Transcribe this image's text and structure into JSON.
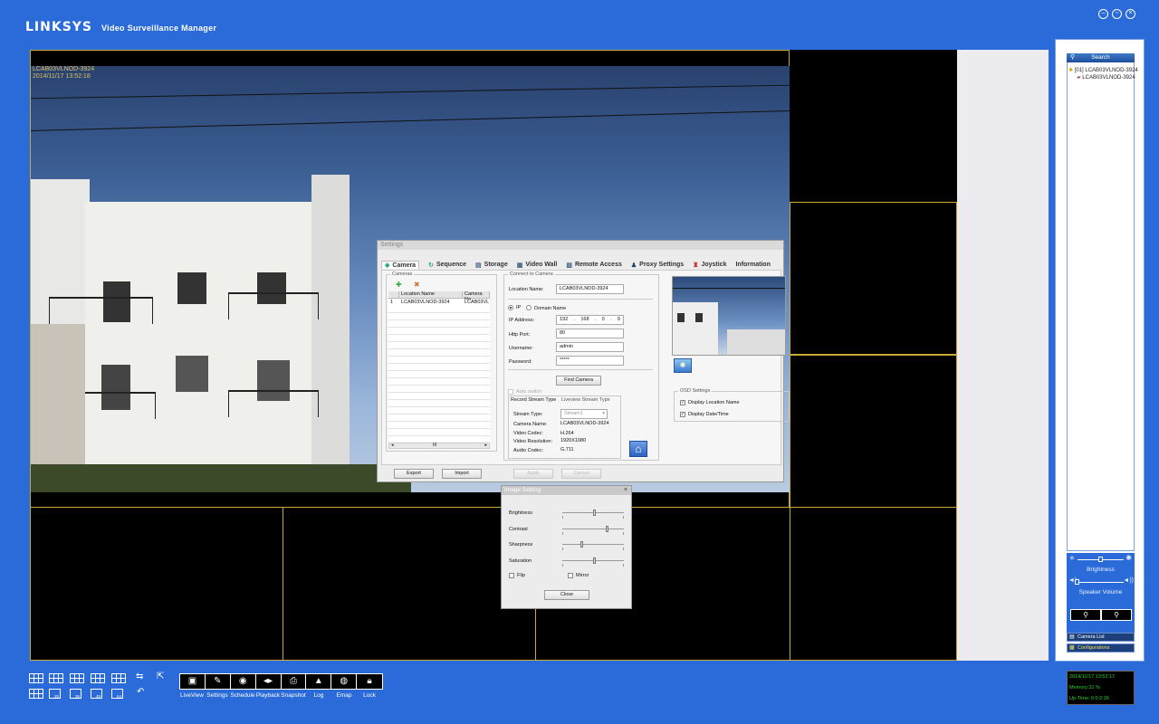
{
  "app": {
    "brand": "LINKSYS",
    "title": "Video Surveillance Manager",
    "window_buttons": [
      "minimize-icon",
      "restore-icon",
      "close-icon"
    ]
  },
  "camera_view": {
    "location_name": "LCAB03VLNOD-3924",
    "datetime": "2014/11/17 13:52:18"
  },
  "settings_dialog": {
    "title": "Settings",
    "tabs": [
      {
        "label": "Camera",
        "icon": "camera-icon"
      },
      {
        "label": "Sequence",
        "icon": "sequence-icon"
      },
      {
        "label": "Storage",
        "icon": "storage-icon"
      },
      {
        "label": "Video Wall",
        "icon": "video-wall-icon"
      },
      {
        "label": "Remote Access",
        "icon": "remote-access-icon"
      },
      {
        "label": "Proxy Settings",
        "icon": "proxy-icon"
      },
      {
        "label": "Joystick",
        "icon": "joystick-icon"
      },
      {
        "label": "Information",
        "icon": ""
      }
    ],
    "cameras_group": "Cameras",
    "table_headers": [
      "Location Name",
      "Camera Na"
    ],
    "table_rows": [
      {
        "index": "1",
        "location": "LCAB03VLNOD-3924",
        "camera": "LCAB03VL"
      }
    ],
    "connect_group": "Connect to Camera",
    "location_label": "Location Name:",
    "location_value": "LCAB03VLNOD-3924",
    "ip_radio": "IP",
    "domain_radio": "Domain Name",
    "ip_label": "IP Address:",
    "ip_octets": [
      "192",
      "168",
      "0",
      "9"
    ],
    "http_label": "Http Port:",
    "http_value": "80",
    "username_label": "Username:",
    "username_value": "admin",
    "password_label": "Password:",
    "password_value": "*****",
    "find_camera": "Find Camera",
    "auto_switch": "Auto switch",
    "stream_tabs": [
      "Record Stream Type",
      "Liveview Stream Type"
    ],
    "stream_type_label": "Stream Type:",
    "stream_type_value": "Stream1",
    "camera_name_label": "Camera Name:",
    "camera_name_value": "LCAB03VLNOD-3924",
    "video_codec_label": "Video Codec:",
    "video_codec_value": "H.264",
    "video_res_label": "Video Resolution:",
    "video_res_value": "1920X1080",
    "audio_codec_label": "Audio Codec:",
    "audio_codec_value": "G.711",
    "osd_group": "OSD Settings",
    "osd_location": "Display Location Name",
    "osd_datetime": "Display Date/Time",
    "export": "Export",
    "import": "Import",
    "apply": "Apply",
    "cancel": "Cancel",
    "scroll_grip": "III"
  },
  "image_setting": {
    "title": "Image Setting",
    "close": "×",
    "brightness": "Brightness",
    "contrast": "Contrast",
    "sharpness": "Sharpness",
    "saturation": "Saturation",
    "brightness_level": 0.5,
    "contrast_level": 0.7,
    "sharpness_level": 0.3,
    "saturation_level": 0.5,
    "flip": "Flip",
    "mirror": "Mirror",
    "close_btn": "Close"
  },
  "right_panel": {
    "search": "Search",
    "tree_root": "[01] LCAB03VLNOD-3924",
    "tree_child": "LCAB03VLNOD-3924",
    "brightness": "Brightness",
    "speaker_volume": "Speaker Volume",
    "camera_list": "Camera List",
    "configurations": "Configurations"
  },
  "status": {
    "datetime": "2014/11/17 13:52:17",
    "memory": "Memory:31 %",
    "uptime": "Up-Time: 0:0:2:26"
  },
  "toolbar": {
    "layout_sizes": [
      "25",
      "36",
      "49",
      "64"
    ],
    "buttons": [
      {
        "label": "LiveView",
        "icon": "liveview-icon",
        "glyph": "▣"
      },
      {
        "label": "Settings",
        "icon": "settings-icon",
        "glyph": "✎"
      },
      {
        "label": "Schedule",
        "icon": "schedule-icon",
        "glyph": "◉"
      },
      {
        "label": "Playback",
        "icon": "playback-icon",
        "glyph": "◂▸"
      },
      {
        "label": "Snapshot",
        "icon": "snapshot-icon",
        "glyph": "⎙"
      },
      {
        "label": "Log",
        "icon": "log-icon",
        "glyph": "▲"
      },
      {
        "label": "Emap",
        "icon": "emap-icon",
        "glyph": "◍"
      },
      {
        "label": "Lock",
        "icon": "lock-icon",
        "glyph": "🔒︎"
      }
    ]
  }
}
